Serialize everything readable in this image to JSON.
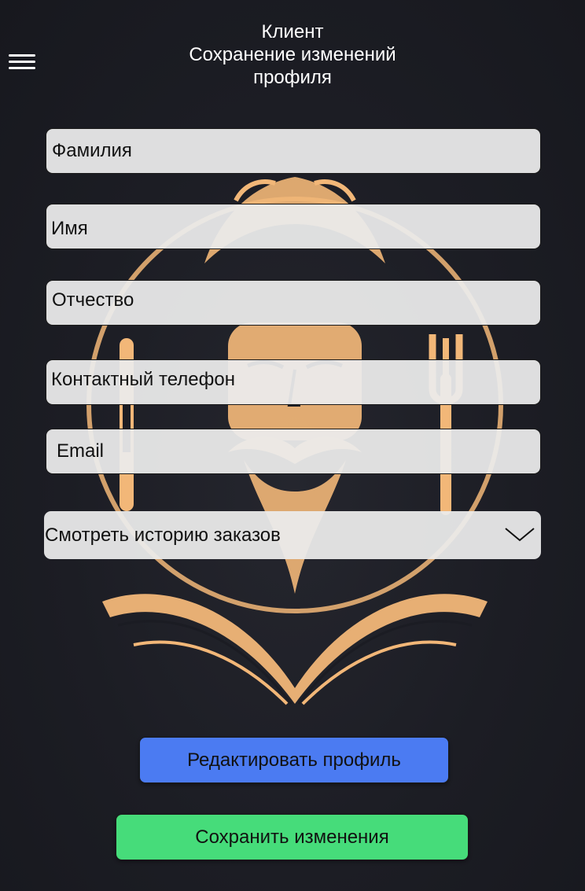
{
  "header": {
    "line1": "Клиент",
    "line2": "Сохранение изменений",
    "line3": "профиля"
  },
  "menu": {
    "icon": "hamburger-menu-icon"
  },
  "form": {
    "last_name_placeholder": "Фамилия",
    "first_name_placeholder": "Имя",
    "patronymic_placeholder": "Отчество",
    "phone_placeholder": "Контактный телефон",
    "email_placeholder": "Email"
  },
  "orders_dropdown": {
    "label": "Смотреть историю заказов",
    "icon": "chevron-down-icon"
  },
  "buttons": {
    "edit_label": "Редактировать профиль",
    "save_label": "Сохранить изменения"
  },
  "colors": {
    "background": "#1b1c23",
    "field_bg": "#ebebeb",
    "edit_button": "#4b7bf2",
    "save_button": "#46dc7a",
    "art_accent": "#f2b778"
  }
}
